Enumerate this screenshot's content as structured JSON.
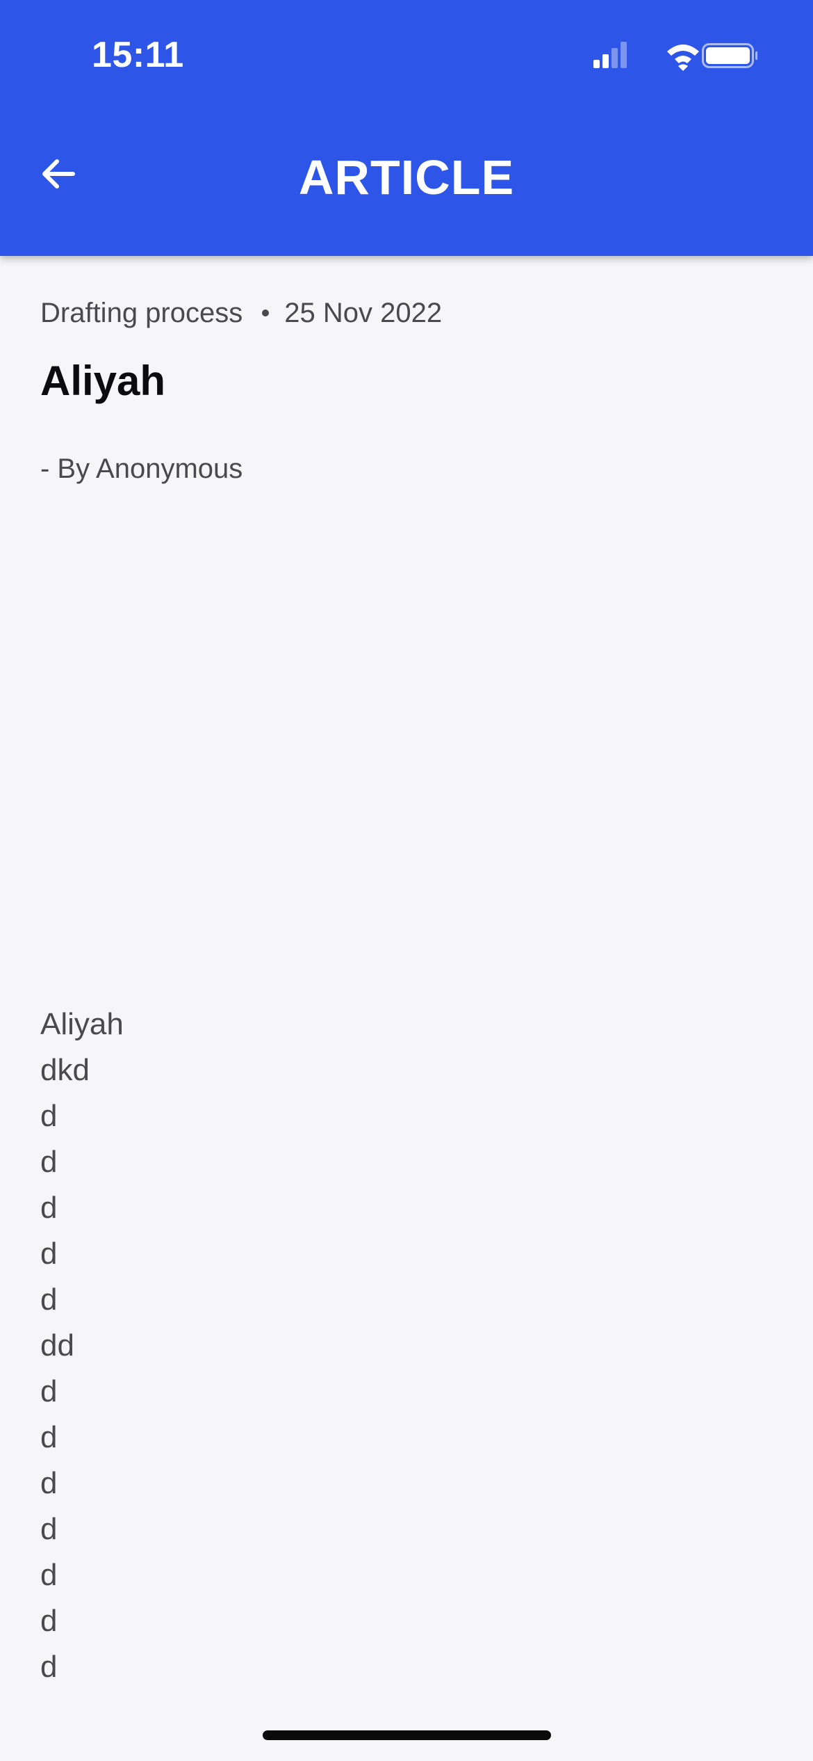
{
  "status_bar": {
    "time": "15:11"
  },
  "header": {
    "back_icon": "arrow-left-icon",
    "title": "ARTICLE"
  },
  "article": {
    "category": "Drafting process",
    "date": "25 Nov 2022",
    "title": "Aliyah",
    "byline": "- By Anonymous",
    "body_lines": [
      "Aliyah",
      "dkd",
      "d",
      "d",
      "d",
      "d",
      "d",
      "dd",
      "d",
      "d",
      "d",
      "d",
      "d",
      "d",
      "d"
    ]
  },
  "colors": {
    "header_bg": "#2d55e8",
    "page_bg": "#f6f6f8",
    "body_text": "#4a4a4e",
    "title_text": "#0c0c0e"
  }
}
